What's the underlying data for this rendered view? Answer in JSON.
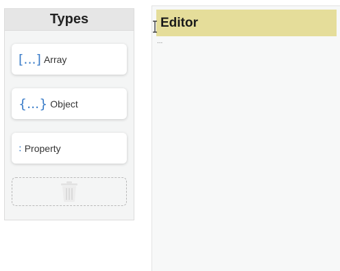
{
  "types_panel": {
    "title": "Types",
    "items": [
      {
        "glyph": "[...]",
        "label": "Array"
      },
      {
        "glyph": "{...}",
        "label": "Object"
      },
      {
        "glyph": ":",
        "label": "Property"
      }
    ],
    "trash_icon": "trash-icon"
  },
  "editor": {
    "title": "Editor",
    "placeholder_dots": "..."
  },
  "colors": {
    "glyph_accent": "#3a7cc8",
    "editor_header_bg": "#e5dd9a",
    "panel_bg": "#f4f5f5"
  }
}
